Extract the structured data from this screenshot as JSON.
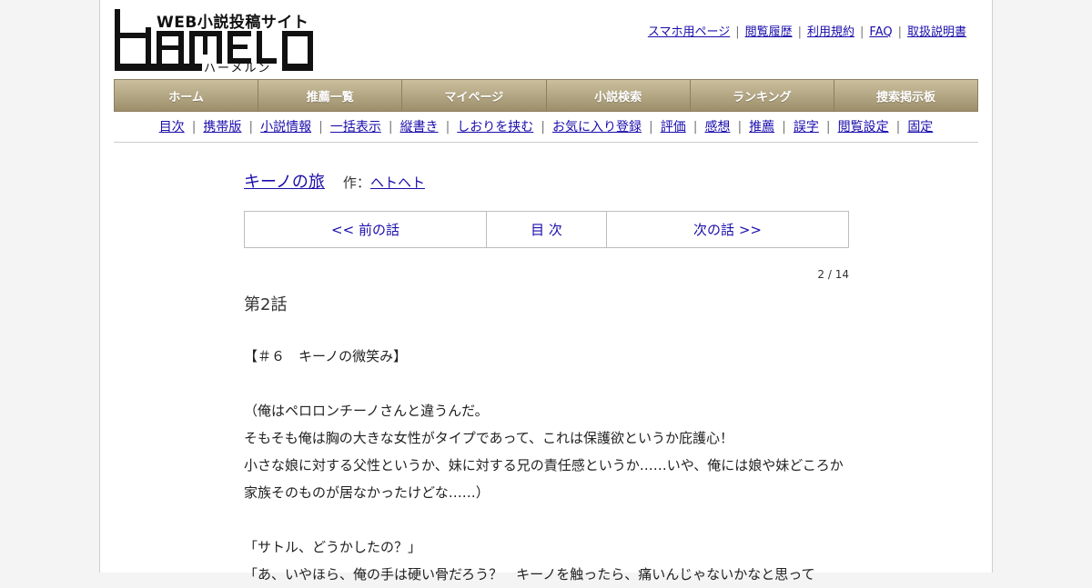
{
  "header": {
    "logo_tagline": "WEB小説投稿サイト",
    "logo_wordmark": "HAMELN",
    "logo_kana": "ハーメルン",
    "top_links": [
      "スマホ用ページ",
      "閲覧履歴",
      "利用規約",
      "FAQ",
      "取扱説明書"
    ]
  },
  "nav": [
    "ホーム",
    "推薦一覧",
    "マイページ",
    "小説検索",
    "ランキング",
    "捜索掲示板"
  ],
  "sub_links": [
    "目次",
    "携帯版",
    "小説情報",
    "一括表示",
    "縦書き",
    "しおりを挟む",
    "お気に入り登録",
    "評価",
    "感想",
    "推薦",
    "誤字",
    "閲覧設定",
    "固定"
  ],
  "novel": {
    "title": "キーノの旅",
    "author_prefix": "作：",
    "author": "ヘトヘト"
  },
  "chapter_nav": {
    "prev": "<< 前の話",
    "toc": "目 次",
    "next": "次の話 >>"
  },
  "page_count": "2 / 14",
  "chapter_title": "第2話",
  "body_lines": [
    "【＃６　キーノの微笑み】",
    "",
    "（俺はペロロンチーノさんと違うんだ。",
    "そもそも俺は胸の大きな女性がタイプであって、これは保護欲というか庇護心！",
    "小さな娘に対する父性というか、妹に対する兄の責任感というか……いや、俺には娘や妹どころか",
    "家族そのものが居なかったけどな……）",
    "",
    "「サトル、どうかしたの？」",
    "「あ、いやほら、俺の手は硬い骨だろう？　キーノを触ったら、痛いんじゃないかなと思って"
  ],
  "colors": {
    "link": "#1a0dab",
    "nav_gradient_top": "#cbbf9f",
    "nav_gradient_bottom": "#9d8f6a"
  }
}
